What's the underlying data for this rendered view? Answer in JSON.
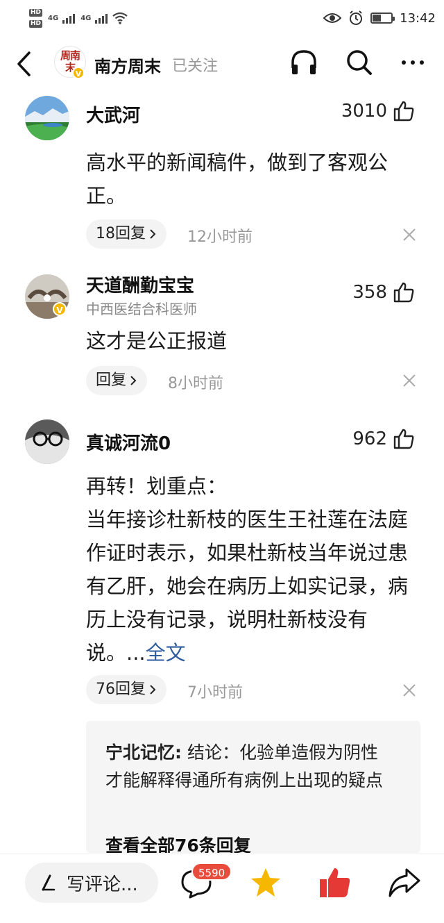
{
  "status_bar": {
    "hd1": "HD",
    "hd2": "HD",
    "net1": "4G",
    "net2": "4G",
    "time": "13:42",
    "battery_level": 0.45
  },
  "nav": {
    "publisher_logo_text": "周南末",
    "publisher_name": "南方周末",
    "follow_status": "已关注",
    "verified_badge": "V"
  },
  "comments": [
    {
      "username": "大武河",
      "likes": "3010",
      "text": "高水平的新闻稿件，做到了客观公正。",
      "reply_chip": "18回复",
      "time": "12小时前"
    },
    {
      "username": "天道酬勤宝宝",
      "subtitle": "中西医结合科医师",
      "likes": "358",
      "text": "这才是公正报道",
      "reply_chip": "回复",
      "time": "8小时前"
    },
    {
      "username": "真诚河流0",
      "likes": "962",
      "text": "再转！划重点：\n当年接诊杜新枝的医生王社莲在法庭作证时表示，如果杜新枝当年说过患有乙肝，她会在病历上如实记录，病历上没有记录，说明杜新枝没有说。...",
      "full_text_link": "全文",
      "reply_chip": "76回复",
      "time": "7小时前",
      "reply_preview": {
        "user": "宁北记忆:",
        "text": " 结论：化验单造假为阴性才能解释得通所有病例上出现的疑点",
        "view_all": "查看全部76条回复"
      }
    }
  ],
  "bottom_bar": {
    "write_placeholder": "写评论...",
    "comment_count": "5590"
  },
  "colors": {
    "accent_blue": "#2f5d9e",
    "star": "#f5b700",
    "like_red": "#e53935",
    "badge_red": "#e74c3c"
  },
  "icons": [
    "back-arrow-icon",
    "headphones-icon",
    "search-icon",
    "more-icon",
    "thumbs-up-icon",
    "chevron-right-icon",
    "close-icon",
    "pen-icon",
    "comment-bubble-icon",
    "star-icon",
    "like-icon",
    "share-icon"
  ]
}
